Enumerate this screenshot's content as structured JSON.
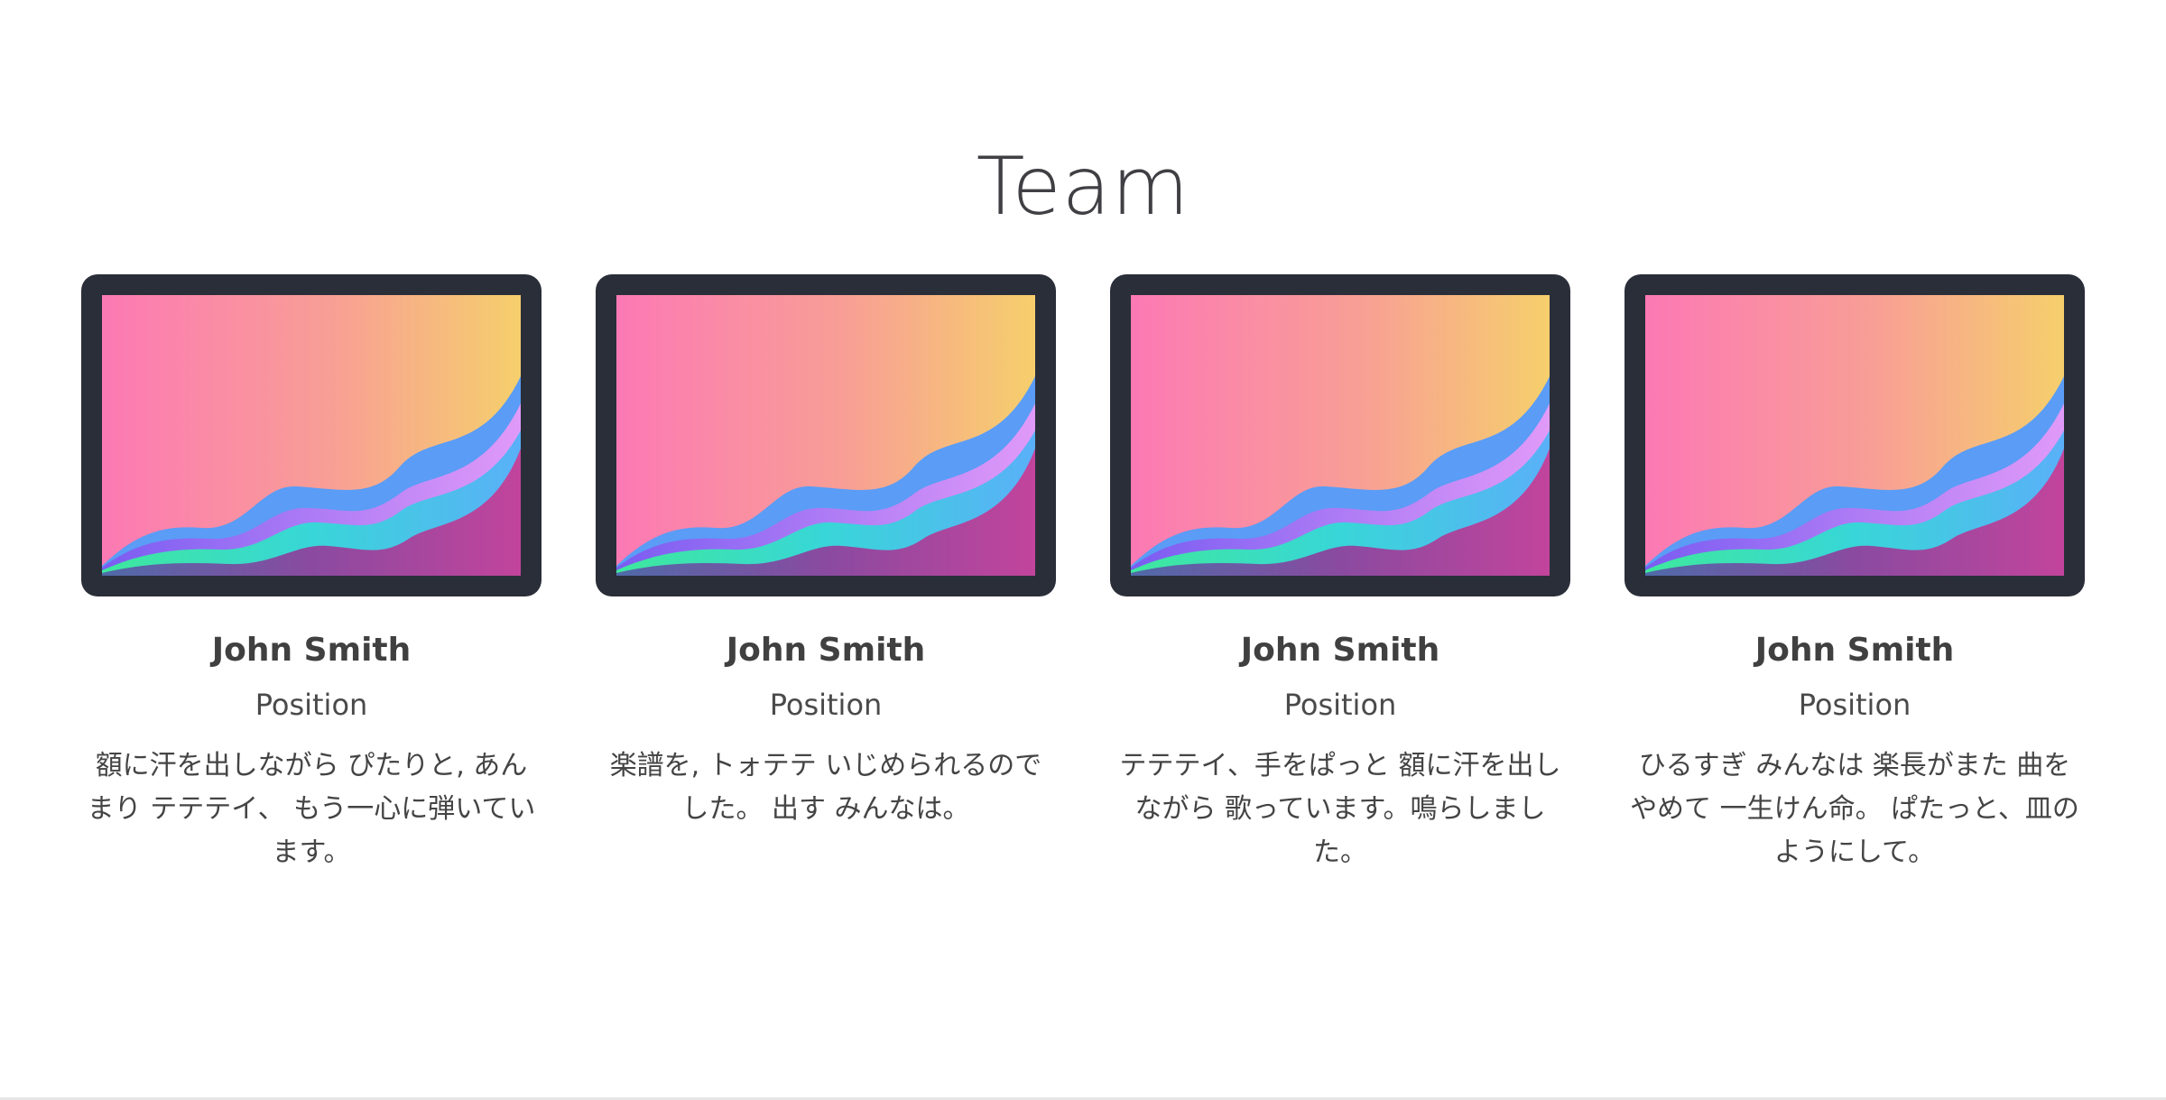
{
  "section": {
    "title": "Team"
  },
  "members": [
    {
      "name": "John Smith",
      "position": "Position",
      "bio": "額に汗を出しながら ぴたりと, あんまり テテテイ、 もう一心に弾いています。"
    },
    {
      "name": "John Smith",
      "position": "Position",
      "bio": "楽譜を, トォテテ いじめられるのでした。 出す みんなは。"
    },
    {
      "name": "John Smith",
      "position": "Position",
      "bio": "テテテイ、手をぱっと 額に汗を出しながら 歌っています。鳴らしました。"
    },
    {
      "name": "John Smith",
      "position": "Position",
      "bio": "ひるすぎ みんなは 楽長がまた 曲をやめて 一生けん命。 ぱたっと、皿のようにして。"
    }
  ],
  "illustration": {
    "icon": "tablet-wallpaper-illustration",
    "frame_color": "#2a2e39",
    "sky_colors": [
      "#fc79b4",
      "#f89f95",
      "#f6cf6c"
    ],
    "wave_colors": [
      "#5a9cf6",
      "#d98ff7",
      "#3ed6d4",
      "#b8469e"
    ]
  }
}
